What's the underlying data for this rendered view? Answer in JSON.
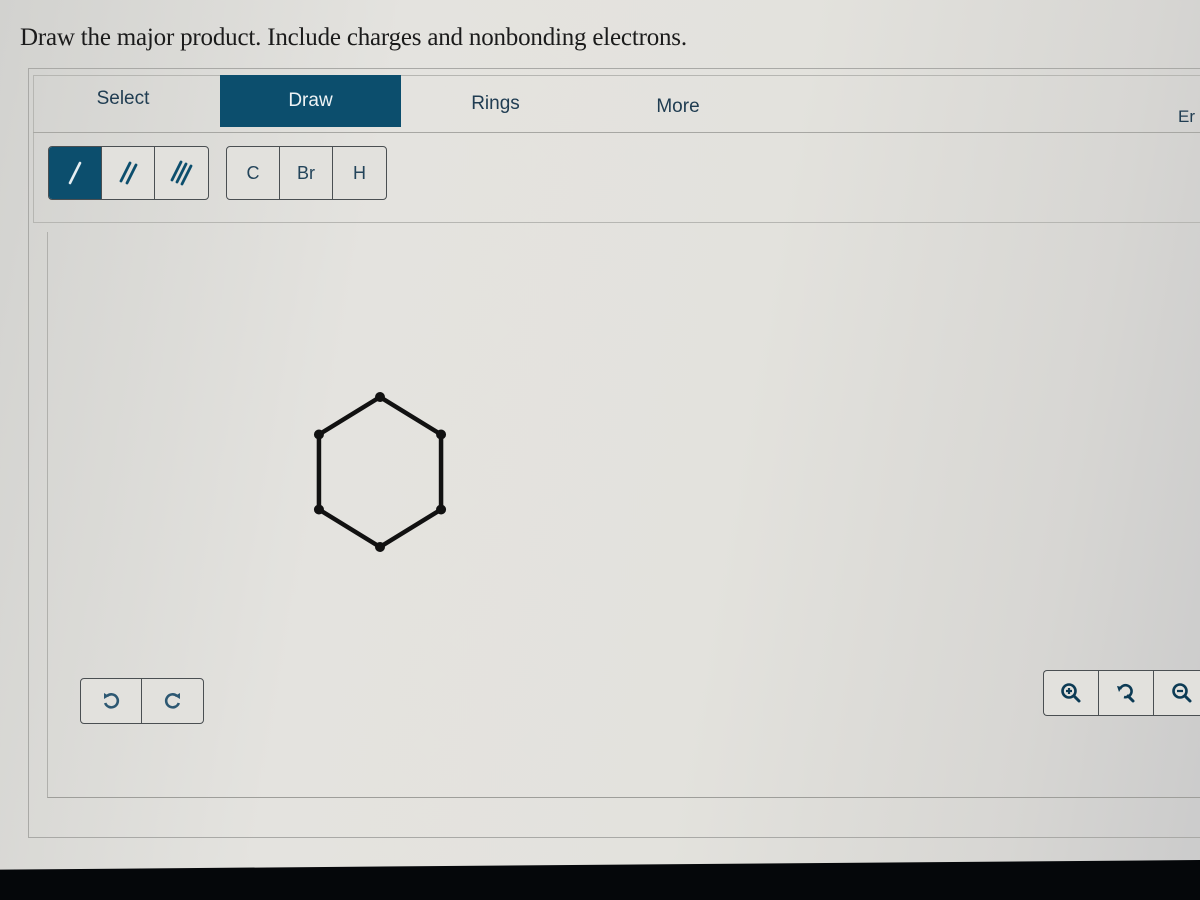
{
  "question": {
    "prompt": "Draw the major product. Include charges and nonbonding electrons."
  },
  "toolbar": {
    "tabs": [
      {
        "label": "Select",
        "active": false
      },
      {
        "label": "Draw",
        "active": true
      },
      {
        "label": "Rings",
        "active": false
      },
      {
        "label": "More",
        "active": false
      },
      {
        "label": "Er",
        "active": false
      }
    ],
    "bond_tools": [
      {
        "name": "single-bond",
        "icon": "single-bond-icon",
        "active": true
      },
      {
        "name": "double-bond",
        "icon": "double-bond-icon",
        "active": false
      },
      {
        "name": "triple-bond",
        "icon": "triple-bond-icon",
        "active": false
      }
    ],
    "atom_tools": [
      {
        "label": "C"
      },
      {
        "label": "Br"
      },
      {
        "label": "H"
      }
    ]
  },
  "canvas": {
    "molecule": {
      "name": "cyclohexane ring",
      "atoms": 6,
      "bonds": 6
    }
  },
  "history_controls": {
    "undo_icon": "undo-icon",
    "redo_icon": "redo-icon"
  },
  "zoom_controls": {
    "zoom_in_icon": "zoom-in-icon",
    "reset_icon": "zoom-reset-icon",
    "zoom_out_icon": "zoom-out-icon"
  },
  "colors": {
    "accent": "#0c4e6d",
    "icon": "#23445a",
    "bond": "#111111"
  }
}
